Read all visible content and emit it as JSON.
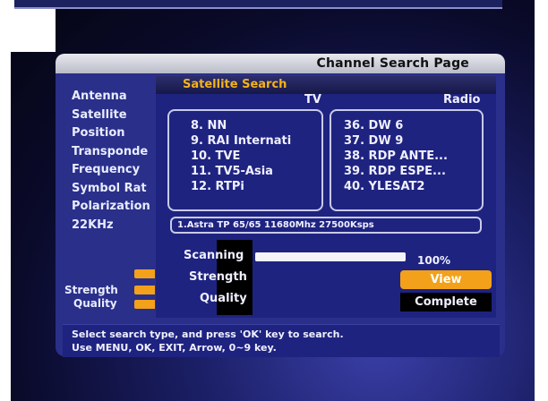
{
  "page_title": "Channel Search Page",
  "menu": {
    "items": [
      "Antenna",
      "Satellite",
      "Position",
      "Transponde",
      "Frequency",
      "Symbol Rat",
      "Polarization",
      "22KHz"
    ],
    "strength_label": "Strength",
    "quality_label": "Quality"
  },
  "popup": {
    "title": "Satellite Search",
    "tv_header": "TV",
    "radio_header": "Radio",
    "tv_channels": [
      "8. NN",
      "9. RAI Internati",
      "10. TVE",
      "11. TV5-Asia",
      "12. RTPi"
    ],
    "radio_channels": [
      "36.  DW 6",
      "37.  DW 9",
      "38.  RDP ANTE...",
      "39.  RDP ESPE...",
      "40.  YLESAT2"
    ],
    "transponder_info": "1.Astra  TP 65/65  11680Mhz 27500Ksps",
    "scanning_label": "Scanning",
    "scanning_percent": "100%",
    "scanning_progress": 1.0,
    "strength_label": "Strength",
    "quality_label": "Quality",
    "view_button": "View",
    "complete_button": "Complete"
  },
  "help": {
    "line1": "Select search type, and press 'OK' key to search.",
    "line2": "Use MENU, OK, EXIT, Arrow, 0~9 key."
  },
  "colors": {
    "accent": "#f3a11a",
    "panel": "#2a2f8a",
    "popup": "#1e2380"
  }
}
